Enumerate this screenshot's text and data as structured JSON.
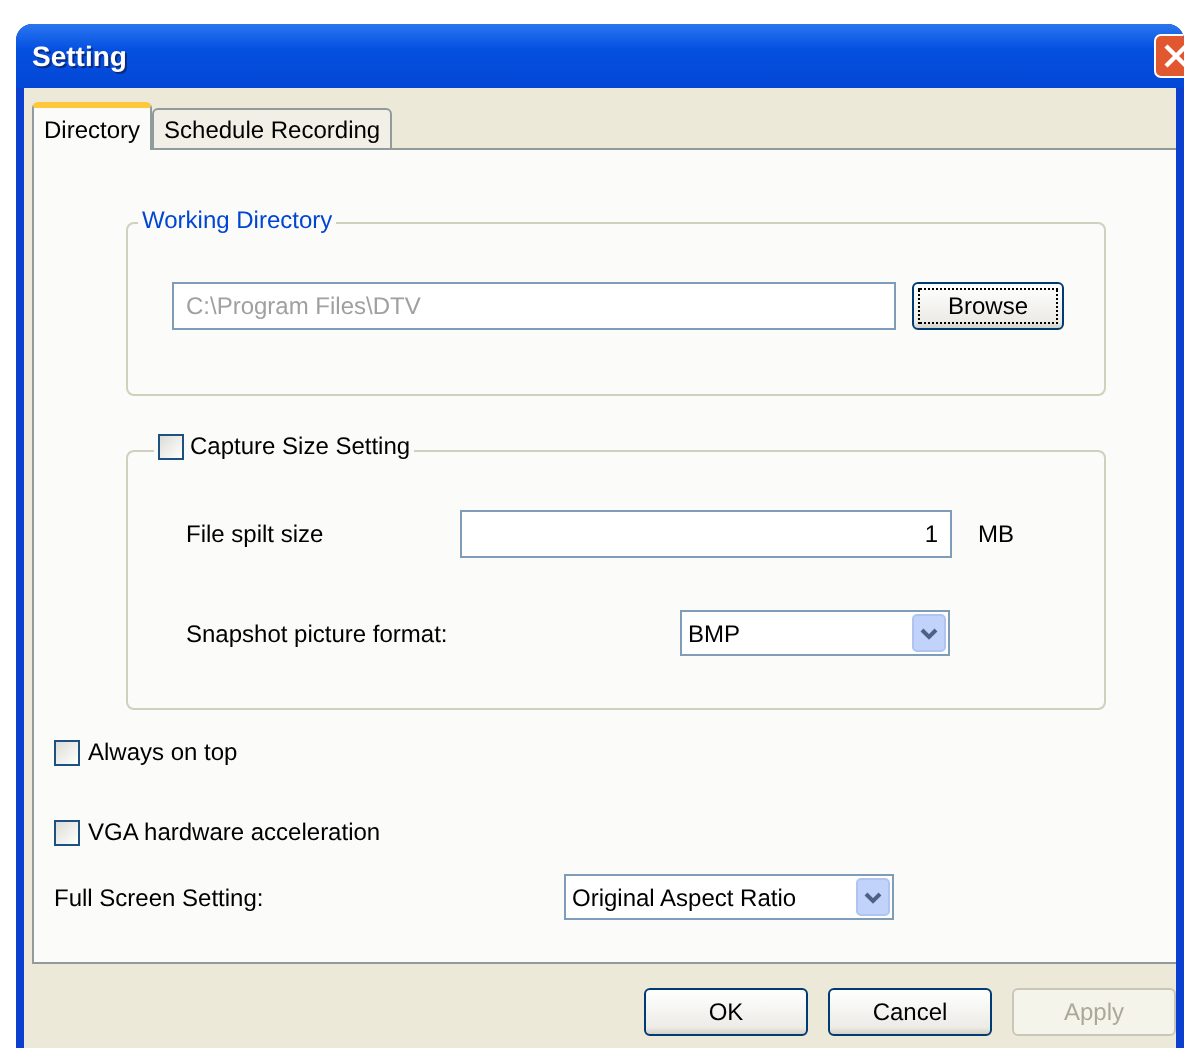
{
  "window": {
    "title": "Setting"
  },
  "tabs": [
    {
      "label": "Directory",
      "selected": true
    },
    {
      "label": "Schedule Recording",
      "selected": false
    }
  ],
  "working_directory": {
    "legend": "Working Directory",
    "value": "C:\\Program Files\\DTV",
    "disabled": true,
    "browse": "Browse"
  },
  "capture": {
    "label": "Capture Size Setting",
    "checked": false,
    "split_label": "File spilt size",
    "split_value": "1",
    "split_unit": "MB",
    "format_label": "Snapshot picture format:",
    "format_value": "BMP"
  },
  "options": [
    {
      "label": "Always on top",
      "checked": false
    },
    {
      "label": "VGA hardware acceleration",
      "checked": false
    }
  ],
  "full_screen": {
    "label": "Full Screen Setting:",
    "value": "Original Aspect Ratio"
  },
  "buttons": [
    {
      "label": "OK",
      "disabled": false
    },
    {
      "label": "Cancel",
      "disabled": false
    },
    {
      "label": "Apply",
      "disabled": true
    }
  ]
}
